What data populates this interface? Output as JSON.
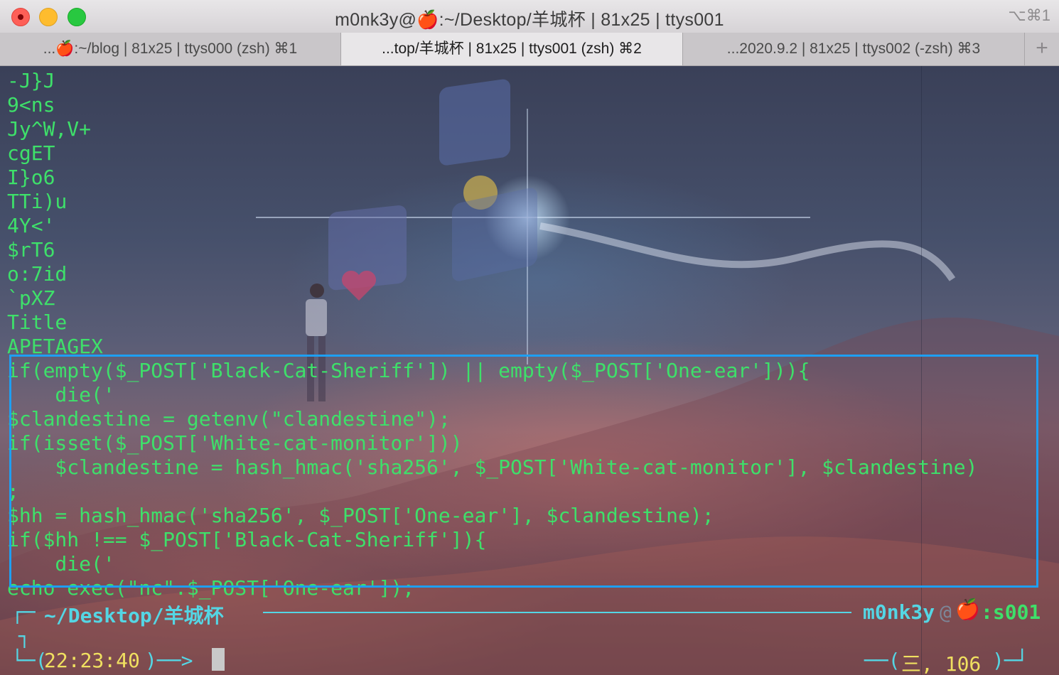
{
  "window": {
    "title": "m0nk3y@🍎:~/Desktop/羊城杯 | 81x25 | ttys001",
    "shortcut": "⌥⌘1"
  },
  "tabs": [
    {
      "label": "...🍎:~/blog | 81x25 | ttys000 (zsh)   ⌘1",
      "active": false
    },
    {
      "label": "...top/羊城杯 | 81x25 | ttys001 (zsh)  ⌘2",
      "active": true
    },
    {
      "label": "...2020.9.2 | 81x25 | ttys002 (-zsh)   ⌘3",
      "active": false
    }
  ],
  "add_tab_label": "+",
  "terminal": {
    "output_lines": [
      "-J}J",
      "9<ns",
      "Jy^W,V+",
      "cgET",
      "I}o6",
      "TTi)u",
      "4Y<'",
      "$rT6",
      "o:7id",
      "`pXZ",
      "Title",
      "APETAGEX",
      "if(empty($_POST['Black-Cat-Sheriff']) || empty($_POST['One-ear'])){",
      "    die('",
      "$clandestine = getenv(\"clandestine\");",
      "if(isset($_POST['White-cat-monitor']))",
      "    $clandestine = hash_hmac('sha256', $_POST['White-cat-monitor'], $clandestine)",
      ";",
      "$hh = hash_hmac('sha256', $_POST['One-ear'], $clandestine);",
      "if($hh !== $_POST['Black-Cat-Sheriff']){",
      "    die('",
      "echo exec(\"nc\".$_POST['One-ear']);"
    ],
    "prompt": {
      "corner_top": "┌─",
      "path": "~/Desktop/羊城杯",
      "user": "m0nk3y",
      "at": "@",
      "apple": "🍎",
      "host": ":s001",
      "corner_mid": "┐",
      "corner_bottom": "└─(",
      "time": "22:23:40",
      "arrow": ")──>",
      "right_open": "──(",
      "right_text": "三, 106",
      "right_close": ")─┘"
    },
    "colors": {
      "text_green": "#3ee06a",
      "prompt_cyan": "#54d6e4",
      "time_yellow": "#f0e060",
      "highlight_blue": "#1e9ff2"
    }
  }
}
